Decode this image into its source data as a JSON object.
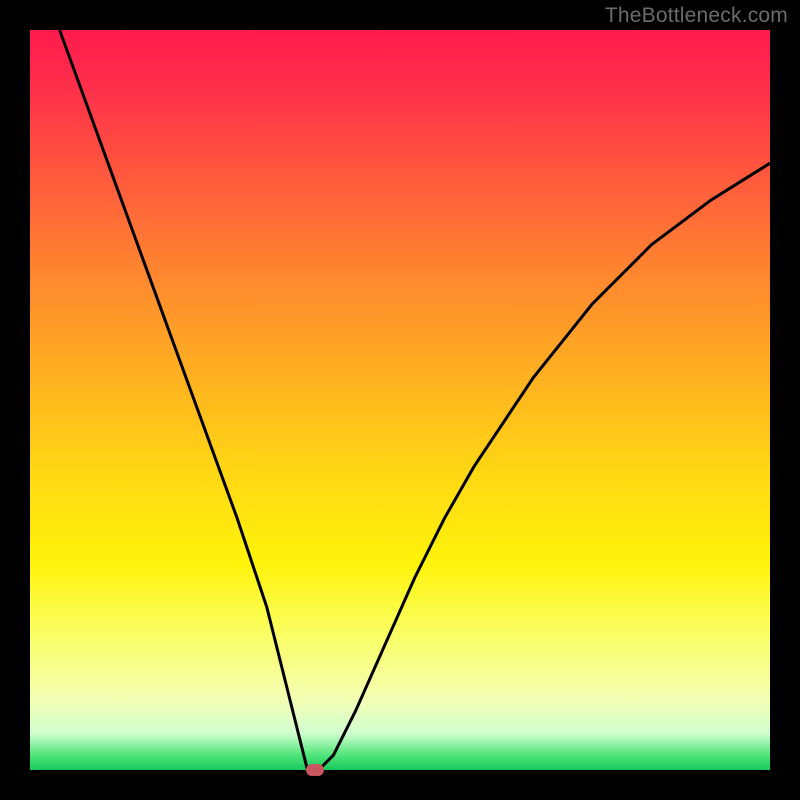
{
  "watermark": "TheBottleneck.com",
  "chart_data": {
    "type": "line",
    "title": "",
    "xlabel": "",
    "ylabel": "",
    "xlim": [
      0,
      100
    ],
    "ylim": [
      0,
      100
    ],
    "grid": false,
    "series": [
      {
        "name": "bottleneck-curve",
        "x": [
          4,
          8,
          12,
          16,
          20,
          24,
          28,
          32,
          34,
          36,
          37,
          37.5,
          38,
          39,
          41,
          44,
          48,
          52,
          56,
          60,
          64,
          68,
          72,
          76,
          80,
          84,
          88,
          92,
          96,
          100
        ],
        "y": [
          100,
          89,
          78,
          67,
          56,
          45,
          34,
          22,
          14,
          6,
          2,
          0,
          0,
          0,
          2,
          8,
          17,
          26,
          34,
          41,
          47,
          53,
          58,
          63,
          67,
          71,
          74,
          77,
          79.5,
          82
        ]
      }
    ],
    "marker": {
      "name": "optimal-point",
      "x": 38.5,
      "y": 0,
      "color": "#c9575f"
    },
    "background_gradient": {
      "top": "#ff1a4d",
      "mid": "#fff30a",
      "bottom": "#18c85c"
    },
    "curve_color": "#000000"
  }
}
